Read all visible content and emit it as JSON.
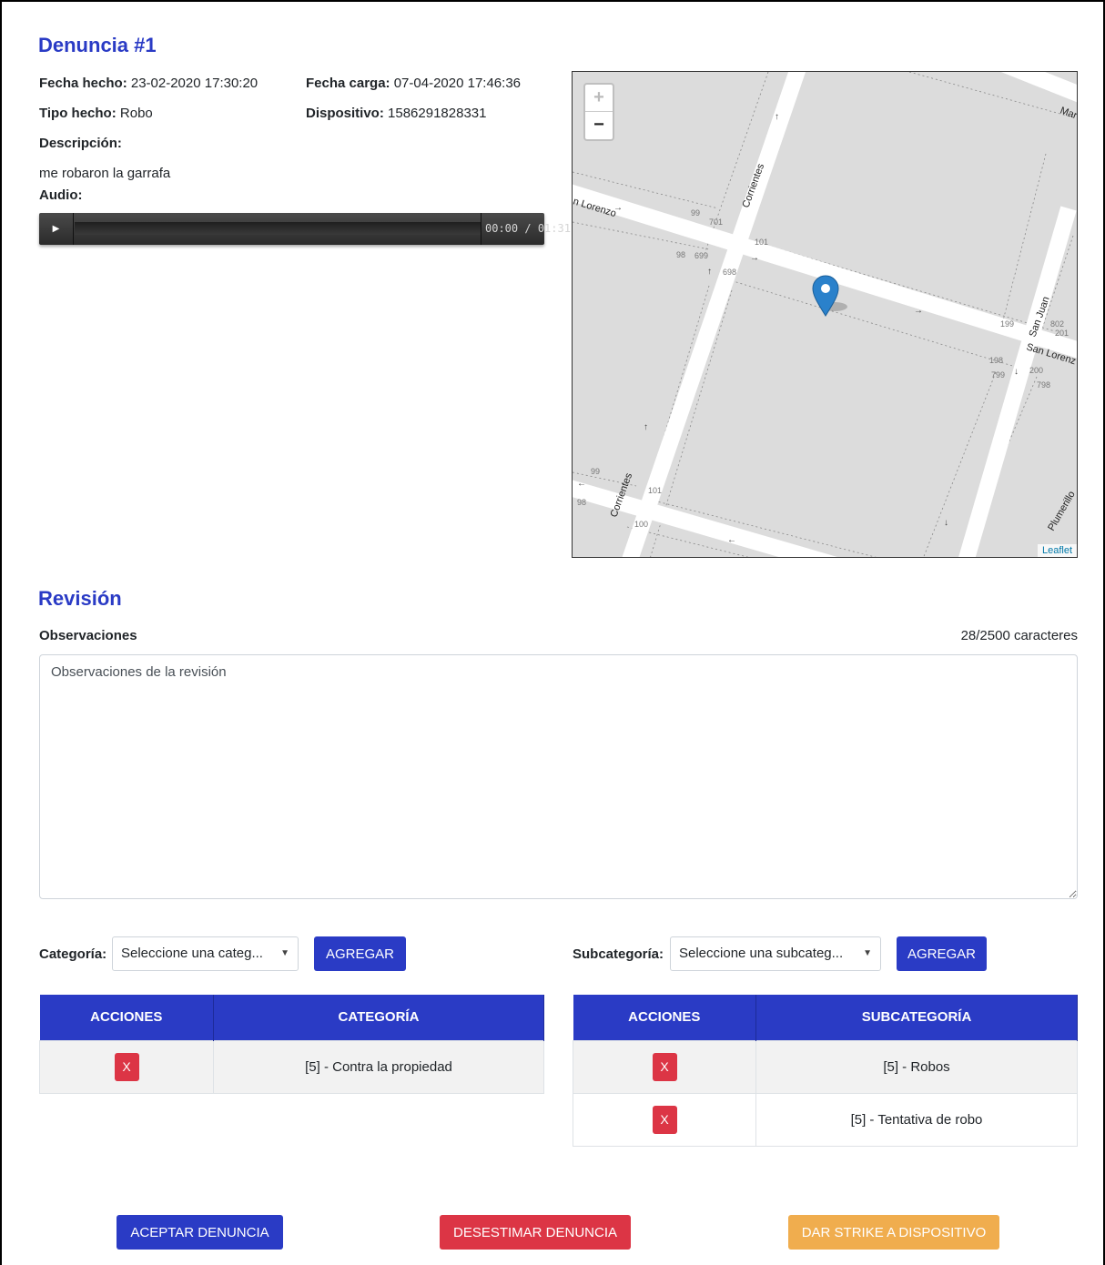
{
  "report": {
    "title": "Denuncia #1",
    "fecha_hecho_label": "Fecha hecho:",
    "fecha_hecho": "23-02-2020 17:30:20",
    "fecha_carga_label": "Fecha carga:",
    "fecha_carga": "07-04-2020 17:46:36",
    "tipo_hecho_label": "Tipo hecho:",
    "tipo_hecho": "Robo",
    "dispositivo_label": "Dispositivo:",
    "dispositivo": "1586291828331",
    "descripcion_label": "Descripción:",
    "descripcion": "me robaron la garrafa",
    "audio_label": "Audio:",
    "audio_current": "00:00",
    "audio_separator": "/",
    "audio_total": "01:31",
    "audio_progress": 0
  },
  "map": {
    "zoom_in": "+",
    "zoom_out": "−",
    "attribution": "Leaflet",
    "street_labels": [
      "Corrientes",
      "n Lorenzo",
      "San Juan",
      "San Lorenz",
      "Mar",
      "Plumerillo",
      "Corrientes"
    ],
    "numbers": [
      "99",
      "701",
      "101",
      "98",
      "699",
      "698",
      "199",
      "802",
      "201",
      "198",
      "799",
      "200",
      "798",
      "99",
      "98",
      "101",
      "100"
    ]
  },
  "review": {
    "title": "Revisión",
    "observaciones_label": "Observaciones",
    "char_counter": "28/2500 caracteres",
    "placeholder": "Observaciones de la revisión"
  },
  "categoria": {
    "label": "Categoría:",
    "select_value": "Seleccione una categ...",
    "add_button": "AGREGAR",
    "columns": [
      "ACCIONES",
      "CATEGORÍA"
    ],
    "rows": [
      {
        "action": "X",
        "value": "[5] - Contra la propiedad"
      }
    ]
  },
  "subcategoria": {
    "label": "Subcategoría:",
    "select_value": "Seleccione una subcateg...",
    "add_button": "AGREGAR",
    "columns": [
      "ACCIONES",
      "SUBCATEGORÍA"
    ],
    "rows": [
      {
        "action": "X",
        "value": "[5] - Robos"
      },
      {
        "action": "X",
        "value": "[5] - Tentativa de robo"
      }
    ]
  },
  "actions": {
    "accept": "ACEPTAR DENUNCIA",
    "dismiss": "DESESTIMAR DENUNCIA",
    "strike": "DAR STRIKE A DISPOSITIVO"
  },
  "colors": {
    "primary": "#2a3bc5",
    "danger": "#dc3545",
    "warning": "#f0ad4e",
    "map_pin": "#2a81cb"
  }
}
